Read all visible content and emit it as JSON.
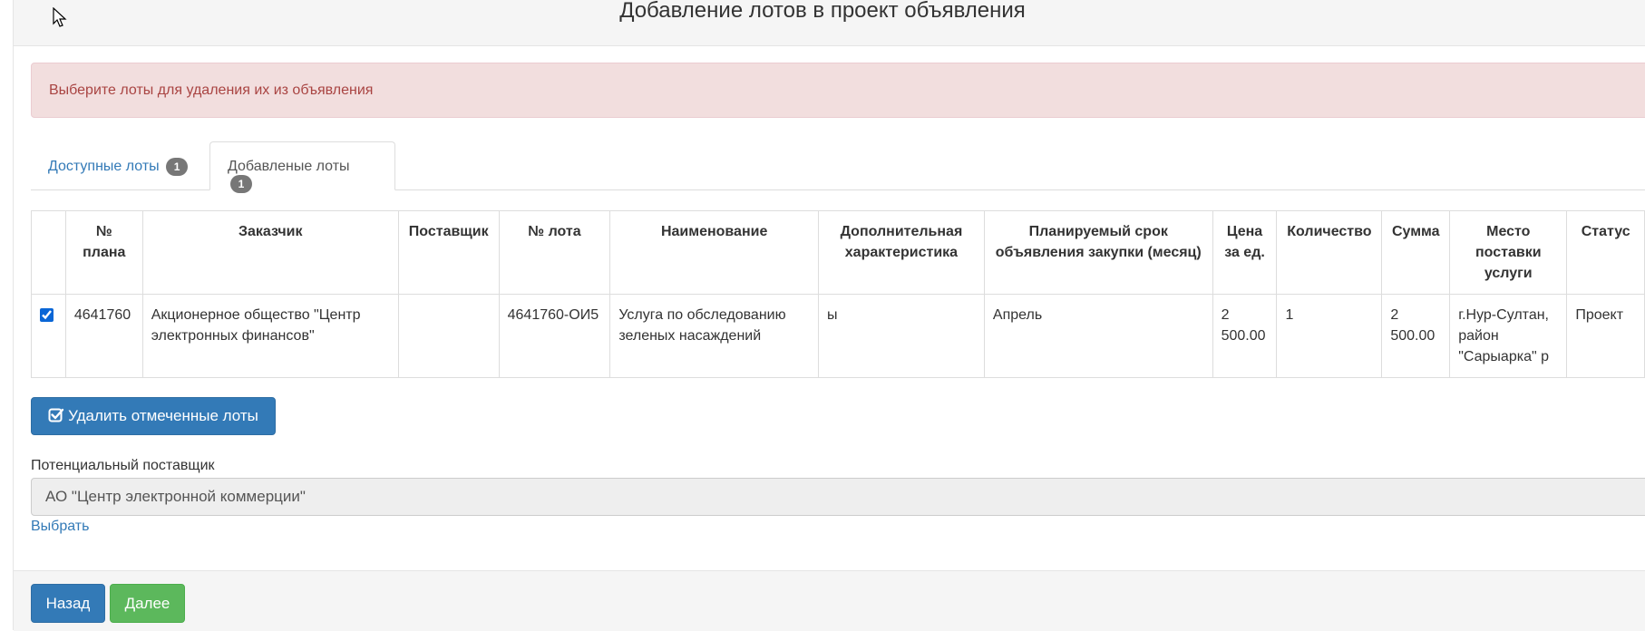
{
  "header": {
    "title": "Добавление лотов в проект объявления"
  },
  "alert": {
    "text": "Выберите лоты для удаления их из объявления"
  },
  "tabs": [
    {
      "label": "Доступные лоты",
      "badge": "1"
    },
    {
      "label": "Добавленые лоты",
      "badge": "1"
    }
  ],
  "table": {
    "headers": [
      "№ плана",
      "Заказчик",
      "Поставщик",
      "№ лота",
      "Наименование",
      "Дополнительная характеристика",
      "Планируемый срок объявления закупки (месяц)",
      "Цена за ед.",
      "Количество",
      "Сумма",
      "Место поставки услуги",
      "Статус"
    ],
    "rows": [
      {
        "checked": true,
        "cells": [
          "4641760",
          "Акционерное общество \"Центр электронных финансов\"",
          "",
          "4641760-ОИ5",
          "Услуга по обследованию зеленых насаждений",
          "ы",
          "Апрель",
          "2 500.00",
          "1",
          "2 500.00",
          "г.Нур-Султан, район \"Сарыарка\" р",
          "Проект"
        ]
      }
    ]
  },
  "actions": {
    "delete_label": "Удалить отмеченные лоты"
  },
  "supplier": {
    "label": "Потенциальный поставщик",
    "value": "АО \"Центр электронной коммерции\"",
    "select_link": "Выбрать"
  },
  "footer": {
    "back_label": "Назад",
    "next_label": "Далее"
  },
  "colors": {
    "primary": "#337ab7",
    "success": "#5cb85c",
    "danger_text": "#a94442",
    "danger_bg": "#f2dede"
  }
}
